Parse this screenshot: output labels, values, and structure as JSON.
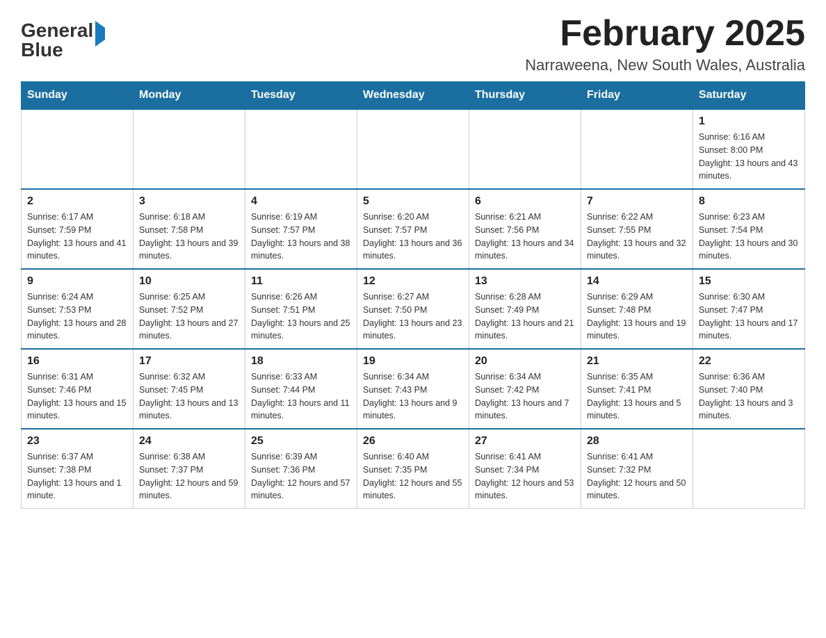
{
  "header": {
    "logo_general": "General",
    "logo_blue": "Blue",
    "month_title": "February 2025",
    "location": "Narraweena, New South Wales, Australia"
  },
  "days_of_week": [
    "Sunday",
    "Monday",
    "Tuesday",
    "Wednesday",
    "Thursday",
    "Friday",
    "Saturday"
  ],
  "weeks": [
    [
      {
        "day": "",
        "sunrise": "",
        "sunset": "",
        "daylight": "",
        "empty": true
      },
      {
        "day": "",
        "sunrise": "",
        "sunset": "",
        "daylight": "",
        "empty": true
      },
      {
        "day": "",
        "sunrise": "",
        "sunset": "",
        "daylight": "",
        "empty": true
      },
      {
        "day": "",
        "sunrise": "",
        "sunset": "",
        "daylight": "",
        "empty": true
      },
      {
        "day": "",
        "sunrise": "",
        "sunset": "",
        "daylight": "",
        "empty": true
      },
      {
        "day": "",
        "sunrise": "",
        "sunset": "",
        "daylight": "",
        "empty": true
      },
      {
        "day": "1",
        "sunrise": "Sunrise: 6:16 AM",
        "sunset": "Sunset: 8:00 PM",
        "daylight": "Daylight: 13 hours and 43 minutes.",
        "empty": false
      }
    ],
    [
      {
        "day": "2",
        "sunrise": "Sunrise: 6:17 AM",
        "sunset": "Sunset: 7:59 PM",
        "daylight": "Daylight: 13 hours and 41 minutes.",
        "empty": false
      },
      {
        "day": "3",
        "sunrise": "Sunrise: 6:18 AM",
        "sunset": "Sunset: 7:58 PM",
        "daylight": "Daylight: 13 hours and 39 minutes.",
        "empty": false
      },
      {
        "day": "4",
        "sunrise": "Sunrise: 6:19 AM",
        "sunset": "Sunset: 7:57 PM",
        "daylight": "Daylight: 13 hours and 38 minutes.",
        "empty": false
      },
      {
        "day": "5",
        "sunrise": "Sunrise: 6:20 AM",
        "sunset": "Sunset: 7:57 PM",
        "daylight": "Daylight: 13 hours and 36 minutes.",
        "empty": false
      },
      {
        "day": "6",
        "sunrise": "Sunrise: 6:21 AM",
        "sunset": "Sunset: 7:56 PM",
        "daylight": "Daylight: 13 hours and 34 minutes.",
        "empty": false
      },
      {
        "day": "7",
        "sunrise": "Sunrise: 6:22 AM",
        "sunset": "Sunset: 7:55 PM",
        "daylight": "Daylight: 13 hours and 32 minutes.",
        "empty": false
      },
      {
        "day": "8",
        "sunrise": "Sunrise: 6:23 AM",
        "sunset": "Sunset: 7:54 PM",
        "daylight": "Daylight: 13 hours and 30 minutes.",
        "empty": false
      }
    ],
    [
      {
        "day": "9",
        "sunrise": "Sunrise: 6:24 AM",
        "sunset": "Sunset: 7:53 PM",
        "daylight": "Daylight: 13 hours and 28 minutes.",
        "empty": false
      },
      {
        "day": "10",
        "sunrise": "Sunrise: 6:25 AM",
        "sunset": "Sunset: 7:52 PM",
        "daylight": "Daylight: 13 hours and 27 minutes.",
        "empty": false
      },
      {
        "day": "11",
        "sunrise": "Sunrise: 6:26 AM",
        "sunset": "Sunset: 7:51 PM",
        "daylight": "Daylight: 13 hours and 25 minutes.",
        "empty": false
      },
      {
        "day": "12",
        "sunrise": "Sunrise: 6:27 AM",
        "sunset": "Sunset: 7:50 PM",
        "daylight": "Daylight: 13 hours and 23 minutes.",
        "empty": false
      },
      {
        "day": "13",
        "sunrise": "Sunrise: 6:28 AM",
        "sunset": "Sunset: 7:49 PM",
        "daylight": "Daylight: 13 hours and 21 minutes.",
        "empty": false
      },
      {
        "day": "14",
        "sunrise": "Sunrise: 6:29 AM",
        "sunset": "Sunset: 7:48 PM",
        "daylight": "Daylight: 13 hours and 19 minutes.",
        "empty": false
      },
      {
        "day": "15",
        "sunrise": "Sunrise: 6:30 AM",
        "sunset": "Sunset: 7:47 PM",
        "daylight": "Daylight: 13 hours and 17 minutes.",
        "empty": false
      }
    ],
    [
      {
        "day": "16",
        "sunrise": "Sunrise: 6:31 AM",
        "sunset": "Sunset: 7:46 PM",
        "daylight": "Daylight: 13 hours and 15 minutes.",
        "empty": false
      },
      {
        "day": "17",
        "sunrise": "Sunrise: 6:32 AM",
        "sunset": "Sunset: 7:45 PM",
        "daylight": "Daylight: 13 hours and 13 minutes.",
        "empty": false
      },
      {
        "day": "18",
        "sunrise": "Sunrise: 6:33 AM",
        "sunset": "Sunset: 7:44 PM",
        "daylight": "Daylight: 13 hours and 11 minutes.",
        "empty": false
      },
      {
        "day": "19",
        "sunrise": "Sunrise: 6:34 AM",
        "sunset": "Sunset: 7:43 PM",
        "daylight": "Daylight: 13 hours and 9 minutes.",
        "empty": false
      },
      {
        "day": "20",
        "sunrise": "Sunrise: 6:34 AM",
        "sunset": "Sunset: 7:42 PM",
        "daylight": "Daylight: 13 hours and 7 minutes.",
        "empty": false
      },
      {
        "day": "21",
        "sunrise": "Sunrise: 6:35 AM",
        "sunset": "Sunset: 7:41 PM",
        "daylight": "Daylight: 13 hours and 5 minutes.",
        "empty": false
      },
      {
        "day": "22",
        "sunrise": "Sunrise: 6:36 AM",
        "sunset": "Sunset: 7:40 PM",
        "daylight": "Daylight: 13 hours and 3 minutes.",
        "empty": false
      }
    ],
    [
      {
        "day": "23",
        "sunrise": "Sunrise: 6:37 AM",
        "sunset": "Sunset: 7:38 PM",
        "daylight": "Daylight: 13 hours and 1 minute.",
        "empty": false
      },
      {
        "day": "24",
        "sunrise": "Sunrise: 6:38 AM",
        "sunset": "Sunset: 7:37 PM",
        "daylight": "Daylight: 12 hours and 59 minutes.",
        "empty": false
      },
      {
        "day": "25",
        "sunrise": "Sunrise: 6:39 AM",
        "sunset": "Sunset: 7:36 PM",
        "daylight": "Daylight: 12 hours and 57 minutes.",
        "empty": false
      },
      {
        "day": "26",
        "sunrise": "Sunrise: 6:40 AM",
        "sunset": "Sunset: 7:35 PM",
        "daylight": "Daylight: 12 hours and 55 minutes.",
        "empty": false
      },
      {
        "day": "27",
        "sunrise": "Sunrise: 6:41 AM",
        "sunset": "Sunset: 7:34 PM",
        "daylight": "Daylight: 12 hours and 53 minutes.",
        "empty": false
      },
      {
        "day": "28",
        "sunrise": "Sunrise: 6:41 AM",
        "sunset": "Sunset: 7:32 PM",
        "daylight": "Daylight: 12 hours and 50 minutes.",
        "empty": false
      },
      {
        "day": "",
        "sunrise": "",
        "sunset": "",
        "daylight": "",
        "empty": true
      }
    ]
  ]
}
